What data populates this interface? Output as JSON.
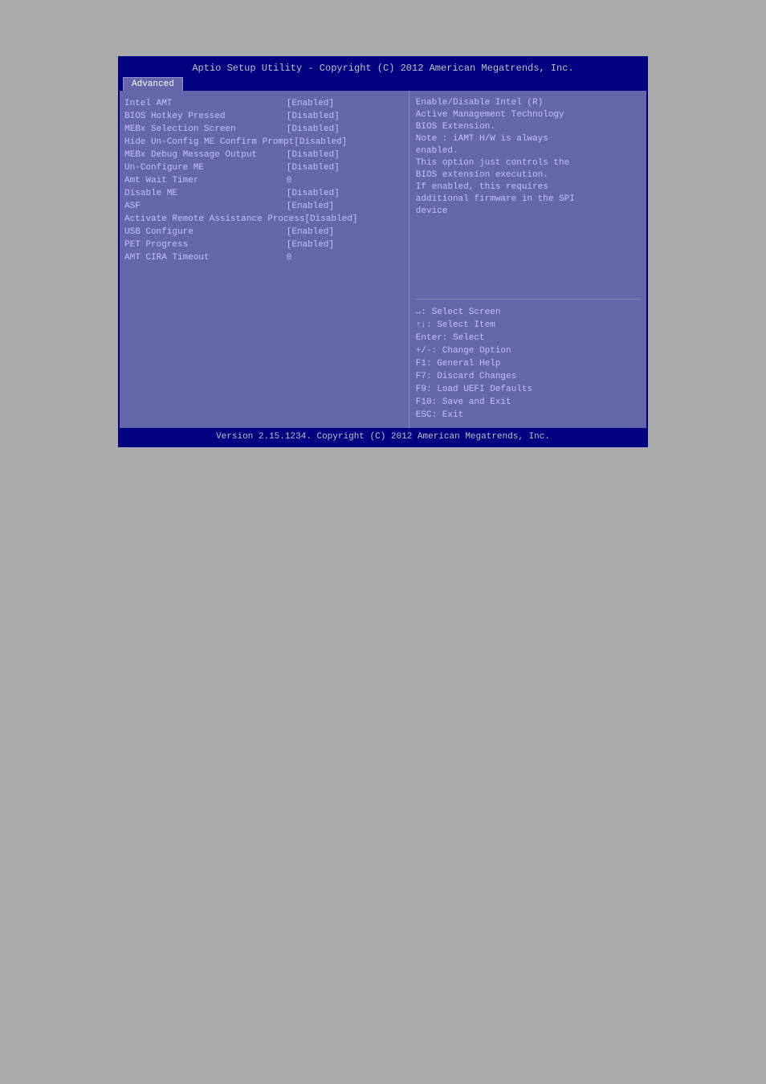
{
  "title_bar": "Aptio Setup Utility - Copyright (C) 2012 American Megatrends, Inc.",
  "tab": "Advanced",
  "settings": [
    {
      "name": "Intel AMT",
      "value": "[Enabled]"
    },
    {
      "name": "BIOS Hotkey Pressed",
      "value": "[Disabled]"
    },
    {
      "name": "MEBx Selection Screen",
      "value": "[Disabled]"
    },
    {
      "name": "Hide Un-Config ME Confirm Prompt",
      "value": "[Disabled]"
    },
    {
      "name": "MEBx Debug Message Output",
      "value": "[Disabled]"
    },
    {
      "name": "Un-Configure ME",
      "value": "[Disabled]"
    },
    {
      "name": "Amt Wait Timer",
      "value": "0"
    },
    {
      "name": "Disable ME",
      "value": "[Disabled]"
    },
    {
      "name": "ASF",
      "value": "[Enabled]"
    },
    {
      "name": "Activate Remote Assistance Process",
      "value": "[Disabled]"
    },
    {
      "name": "USB Configure",
      "value": "[Enabled]"
    },
    {
      "name": "PET Progress",
      "value": "[Enabled]"
    },
    {
      "name": "AMT CIRA Timeout",
      "value": "0"
    }
  ],
  "help": {
    "lines": [
      "Enable/Disable Intel (R)",
      "Active Management Technology",
      "BIOS Extension.",
      "Note : iAMT H/W is always",
      "enabled.",
      "This option just controls the",
      "BIOS extension execution.",
      "If enabled, this requires",
      "additional firmware in the SPI",
      "device"
    ]
  },
  "key_help": [
    "↔: Select Screen",
    "↑↓: Select Item",
    "Enter: Select",
    "+/-: Change Option",
    "F1: General Help",
    "F7: Discard Changes",
    "F9: Load UEFI Defaults",
    "F10: Save and Exit",
    "ESC: Exit"
  ],
  "footer": "Version 2.15.1234. Copyright (C) 2012 American Megatrends, Inc."
}
